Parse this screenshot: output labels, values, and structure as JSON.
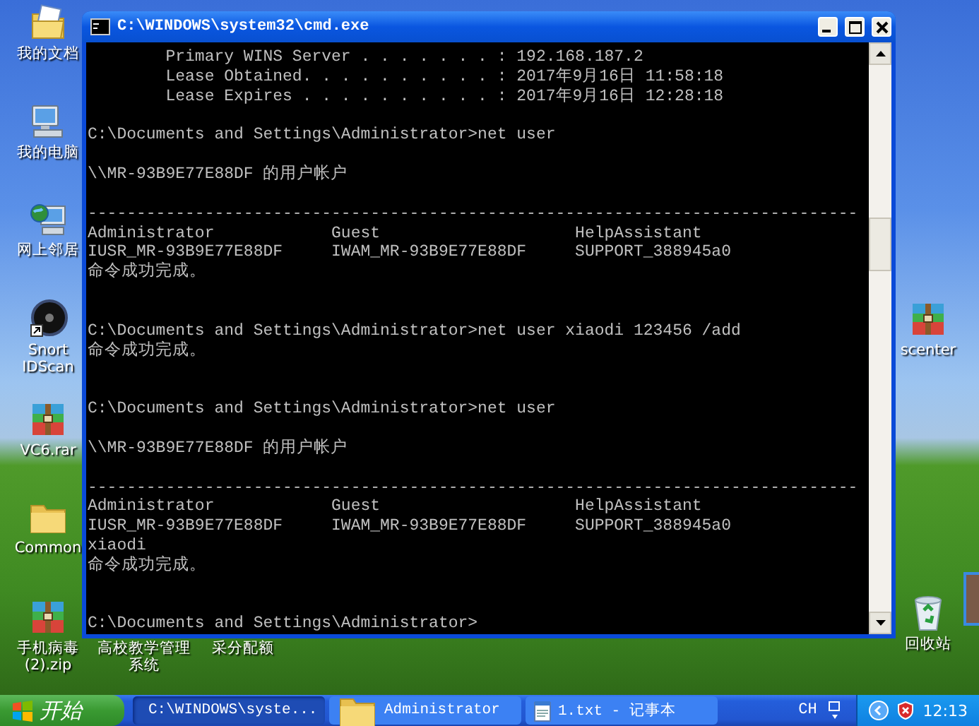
{
  "desktop": {
    "icons": [
      {
        "label": "我的文档",
        "kind": "documents"
      },
      {
        "label": "我的电脑",
        "kind": "computer"
      },
      {
        "label": "网上邻居",
        "kind": "network"
      },
      {
        "label": "Snort\nIDScan",
        "kind": "disc"
      },
      {
        "label": "VC6.rar",
        "kind": "archive"
      },
      {
        "label": "Common",
        "kind": "folder"
      },
      {
        "label": "手机病毒\n(2).zip",
        "kind": "archive"
      },
      {
        "label": "高校教学管理系统",
        "kind": "covered"
      },
      {
        "label": "采分配额",
        "kind": "covered"
      },
      {
        "label": "scenter",
        "kind": "archive"
      },
      {
        "label": "回收站",
        "kind": "recycle"
      },
      {
        "kind": "photo"
      }
    ]
  },
  "window": {
    "title": "C:\\WINDOWS\\system32\\cmd.exe",
    "lines": [
      {
        "kind": "text",
        "text": "        Primary WINS Server . . . . . . . : 192.168.187.2"
      },
      {
        "kind": "text",
        "text": "        Lease Obtained. . . . . . . . . . : 2017年9月16日 11:58:18"
      },
      {
        "kind": "text",
        "text": "        Lease Expires . . . . . . . . . . : 2017年9月16日 12:28:18"
      },
      {
        "kind": "blank"
      },
      {
        "kind": "text",
        "text": "C:\\Documents and Settings\\Administrator>net user"
      },
      {
        "kind": "blank"
      },
      {
        "kind": "text",
        "text": "\\\\MR-93B9E77E88DF 的用户帐户"
      },
      {
        "kind": "blank"
      },
      {
        "kind": "text",
        "text": "-------------------------------------------------------------------------------"
      },
      {
        "kind": "text",
        "text": "Administrator            Guest                    HelpAssistant"
      },
      {
        "kind": "text",
        "text": "IUSR_MR-93B9E77E88DF     IWAM_MR-93B9E77E88DF     SUPPORT_388945a0"
      },
      {
        "kind": "text",
        "text": "命令成功完成。"
      },
      {
        "kind": "blank"
      },
      {
        "kind": "blank"
      },
      {
        "kind": "text",
        "text": "C:\\Documents and Settings\\Administrator>net user xiaodi 123456 /add"
      },
      {
        "kind": "text",
        "text": "命令成功完成。"
      },
      {
        "kind": "blank"
      },
      {
        "kind": "blank"
      },
      {
        "kind": "text",
        "text": "C:\\Documents and Settings\\Administrator>net user"
      },
      {
        "kind": "blank"
      },
      {
        "kind": "text",
        "text": "\\\\MR-93B9E77E88DF 的用户帐户"
      },
      {
        "kind": "blank"
      },
      {
        "kind": "text",
        "text": "-------------------------------------------------------------------------------"
      },
      {
        "kind": "text",
        "text": "Administrator            Guest                    HelpAssistant"
      },
      {
        "kind": "text",
        "text": "IUSR_MR-93B9E77E88DF     IWAM_MR-93B9E77E88DF     SUPPORT_388945a0"
      },
      {
        "kind": "text",
        "text": "xiaodi"
      },
      {
        "kind": "text",
        "text": "命令成功完成。"
      },
      {
        "kind": "blank"
      },
      {
        "kind": "blank"
      },
      {
        "kind": "text",
        "text": "C:\\Documents and Settings\\Administrator>"
      }
    ]
  },
  "taskbar": {
    "start": "开始",
    "tasks": [
      {
        "label": "C:\\WINDOWS\\syste...",
        "kind": "console",
        "selected": true
      },
      {
        "label": "Administrator",
        "kind": "folder",
        "selected": false
      },
      {
        "label": "1.txt - 记事本",
        "kind": "notepad",
        "selected": false
      }
    ],
    "tray": {
      "language": "CH",
      "clock": "12:13"
    }
  }
}
